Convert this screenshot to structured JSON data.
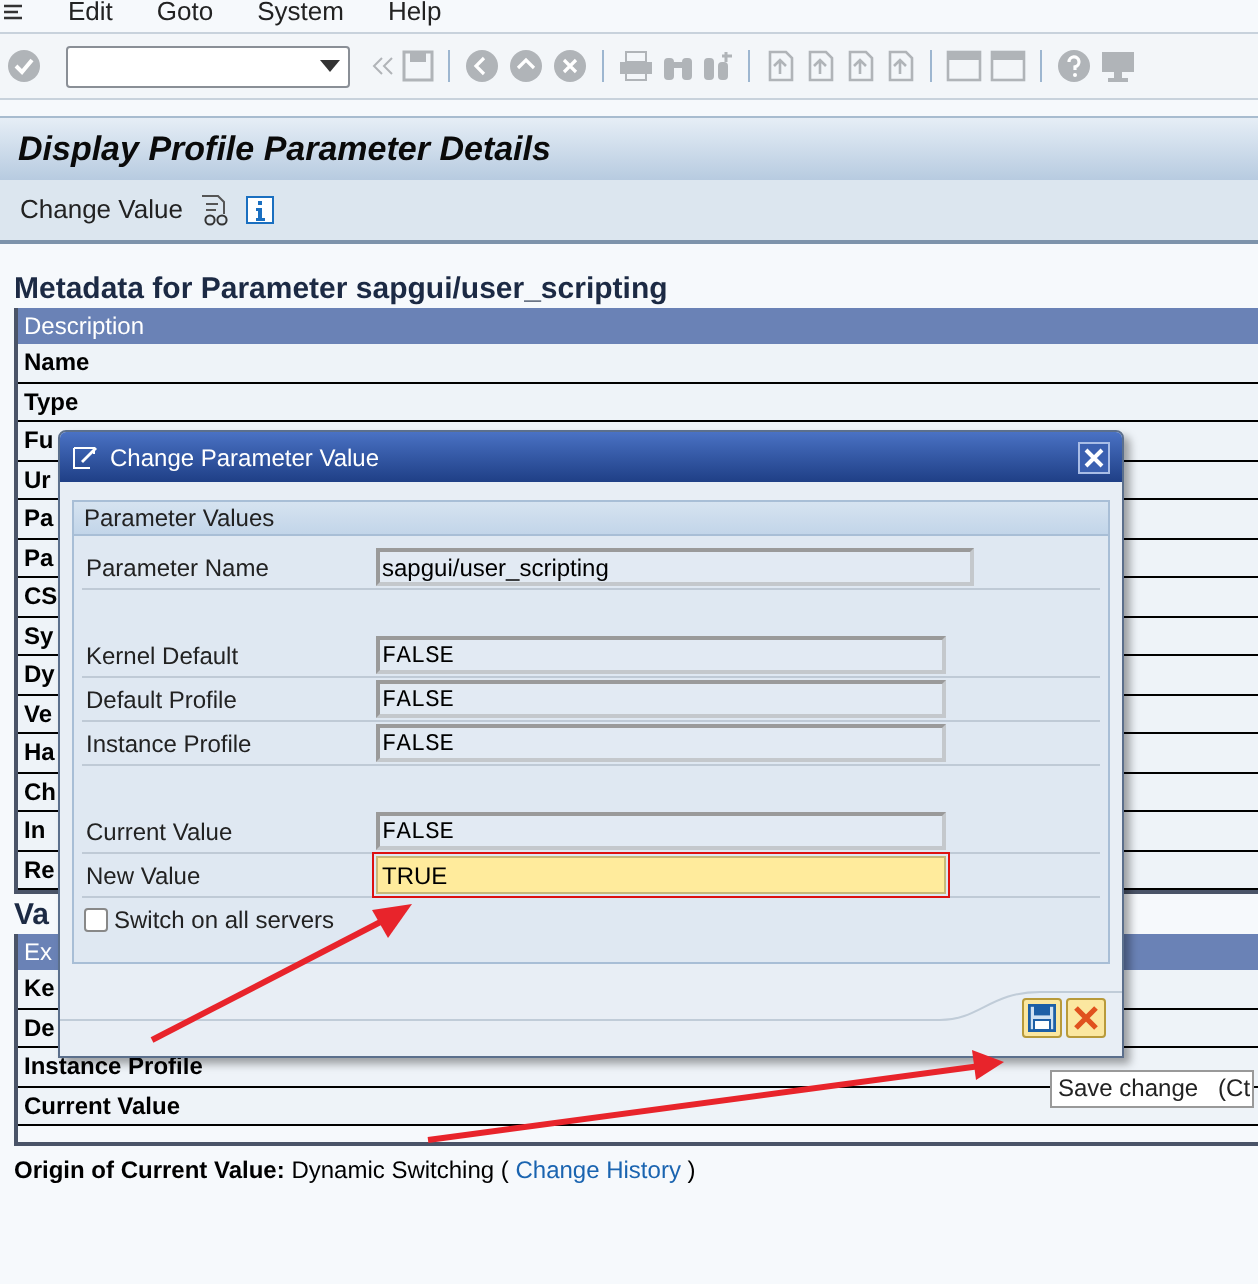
{
  "menu_bar": [
    {
      "label": "Edit"
    },
    {
      "label": "Goto"
    },
    {
      "label": "System"
    },
    {
      "label": "Help"
    }
  ],
  "title": "Display Profile Parameter Details",
  "app_toolbar": {
    "button": "Change Value"
  },
  "metadata": {
    "heading": "Metadata for Parameter sapgui/user_scripting",
    "header": "Description",
    "rows": [
      "Name",
      "Type",
      "Fu",
      "Ur",
      "Pa",
      "Pa",
      "CS",
      "Sy",
      "Dy",
      "Ve",
      "Ha",
      "Ch",
      "In",
      "Re"
    ]
  },
  "values": {
    "heading": "Va",
    "header": "Ex",
    "rows": [
      "Ke",
      "De",
      "Instance Profile",
      "Current Value"
    ]
  },
  "origin": {
    "label": "Origin of Current Value:",
    "value": "Dynamic Switching (",
    "link": "Change History",
    "close": ")"
  },
  "dialog": {
    "title": "Change Parameter Value",
    "group": "Parameter Values",
    "field_groups": [
      [
        {
          "label": "Parameter Name",
          "value": "sapgui/user_scripting",
          "kind": "display"
        }
      ],
      [
        {
          "label": "Kernel Default",
          "value": "FALSE",
          "kind": "display"
        },
        {
          "label": "Default Profile",
          "value": "FALSE",
          "kind": "display"
        },
        {
          "label": "Instance Profile",
          "value": "FALSE",
          "kind": "display"
        }
      ],
      [
        {
          "label": "Current Value",
          "value": "FALSE",
          "kind": "display"
        },
        {
          "label": "New Value",
          "value": "TRUE",
          "kind": "input"
        }
      ]
    ],
    "checkbox": {
      "label": "Switch on all servers",
      "checked": false
    }
  },
  "tooltip": "Save change   (Ct"
}
